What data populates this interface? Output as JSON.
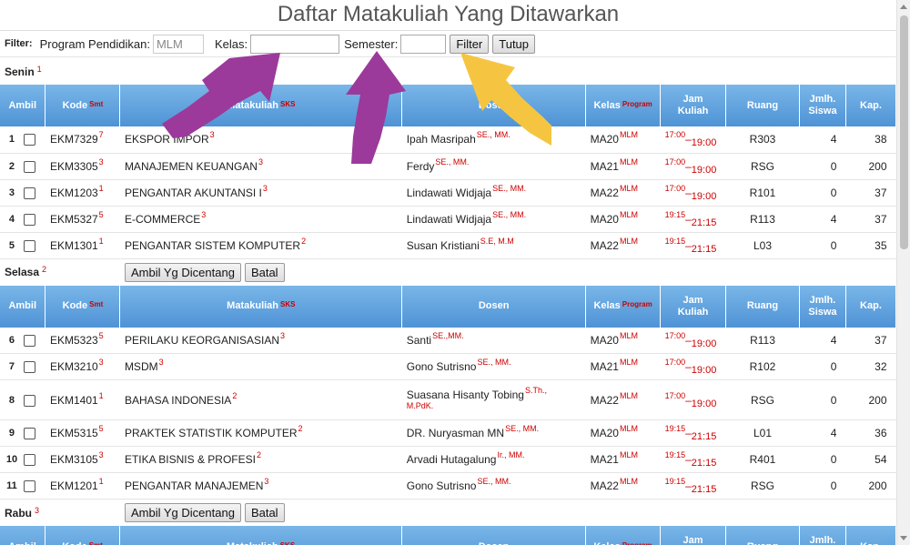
{
  "page_title": "Daftar Matakuliah Yang Ditawarkan",
  "filter": {
    "label": "Filter:",
    "program_label": "Program Pendidikan:",
    "program_value": "MLM",
    "kelas_label": "Kelas:",
    "kelas_value": "",
    "semester_label": "Semester:",
    "semester_value": "",
    "filter_button": "Filter",
    "close_button": "Tutup"
  },
  "columns": {
    "ambil": "Ambil",
    "kode": "Kode",
    "kode_sup": "Smt",
    "matakuliah": "Matakuliah",
    "matakuliah_sup": "SKS",
    "dosen": "Dosen",
    "kelas": "Kelas",
    "kelas_sup": "Program",
    "jam_line1": "Jam",
    "jam_line2": "Kuliah",
    "ruang": "Ruang",
    "jumlah_line1": "Jmlh.",
    "jumlah_line2": "Siswa",
    "kapasitas": "Kap."
  },
  "actions": {
    "take_checked": "Ambil Yg Dicentang",
    "cancel": "Batal"
  },
  "days": [
    {
      "name": "Senin",
      "sup": "1",
      "rows": [
        {
          "no": "1",
          "kode": "EKM7329",
          "smt": "7",
          "mk": "EKSPOR IMPOR",
          "sks": "3",
          "dosen": "Ipah Masripah",
          "gelar": "SE., MM.",
          "gelar2": "",
          "kelas": "MA20",
          "program": "MLM",
          "jam_start": "17:00",
          "jam_end": "19:00",
          "ruang": "R303",
          "siswa": "4",
          "kap": "38"
        },
        {
          "no": "2",
          "kode": "EKM3305",
          "smt": "3",
          "mk": "MANAJEMEN KEUANGAN",
          "sks": "3",
          "dosen": "Ferdy",
          "gelar": "SE., MM.",
          "gelar2": "",
          "kelas": "MA21",
          "program": "MLM",
          "jam_start": "17:00",
          "jam_end": "19:00",
          "ruang": "RSG",
          "siswa": "0",
          "kap": "200"
        },
        {
          "no": "3",
          "kode": "EKM1203",
          "smt": "1",
          "mk": "PENGANTAR AKUNTANSI I",
          "sks": "3",
          "dosen": "Lindawati Widjaja",
          "gelar": "SE., MM.",
          "gelar2": "",
          "kelas": "MA22",
          "program": "MLM",
          "jam_start": "17:00",
          "jam_end": "19:00",
          "ruang": "R101",
          "siswa": "0",
          "kap": "37"
        },
        {
          "no": "4",
          "kode": "EKM5327",
          "smt": "5",
          "mk": "E-COMMERCE",
          "sks": "3",
          "dosen": "Lindawati Widjaja",
          "gelar": "SE., MM.",
          "gelar2": "",
          "kelas": "MA20",
          "program": "MLM",
          "jam_start": "19:15",
          "jam_end": "21:15",
          "ruang": "R113",
          "siswa": "4",
          "kap": "37"
        },
        {
          "no": "5",
          "kode": "EKM1301",
          "smt": "1",
          "mk": "PENGANTAR SISTEM KOMPUTER",
          "sks": "2",
          "dosen": "Susan Kristiani",
          "gelar": "S.E, M.M",
          "gelar2": "",
          "kelas": "MA22",
          "program": "MLM",
          "jam_start": "19:15",
          "jam_end": "21:15",
          "ruang": "L03",
          "siswa": "0",
          "kap": "35"
        }
      ]
    },
    {
      "name": "Selasa",
      "sup": "2",
      "rows": [
        {
          "no": "6",
          "kode": "EKM5323",
          "smt": "5",
          "mk": "PERILAKU KEORGANISASIAN",
          "sks": "3",
          "dosen": "Santi",
          "gelar": "SE.,MM.",
          "gelar2": "",
          "kelas": "MA20",
          "program": "MLM",
          "jam_start": "17:00",
          "jam_end": "19:00",
          "ruang": "R113",
          "siswa": "4",
          "kap": "37"
        },
        {
          "no": "7",
          "kode": "EKM3210",
          "smt": "3",
          "mk": "MSDM",
          "sks": "3",
          "dosen": "Gono Sutrisno",
          "gelar": "SE., MM.",
          "gelar2": "",
          "kelas": "MA21",
          "program": "MLM",
          "jam_start": "17:00",
          "jam_end": "19:00",
          "ruang": "R102",
          "siswa": "0",
          "kap": "32"
        },
        {
          "no": "8",
          "kode": "EKM1401",
          "smt": "1",
          "mk": "BAHASA INDONESIA",
          "sks": "2",
          "dosen": "Suasana Hisanty Tobing",
          "gelar": "S.Th.,",
          "gelar2": "M.PdK.",
          "kelas": "MA22",
          "program": "MLM",
          "jam_start": "17:00",
          "jam_end": "19:00",
          "ruang": "RSG",
          "siswa": "0",
          "kap": "200"
        },
        {
          "no": "9",
          "kode": "EKM5315",
          "smt": "5",
          "mk": "PRAKTEK STATISTIK KOMPUTER",
          "sks": "2",
          "dosen": "DR. Nuryasman MN",
          "gelar": "SE., MM.",
          "gelar2": "",
          "kelas": "MA20",
          "program": "MLM",
          "jam_start": "19:15",
          "jam_end": "21:15",
          "ruang": "L01",
          "siswa": "4",
          "kap": "36"
        },
        {
          "no": "10",
          "kode": "EKM3105",
          "smt": "3",
          "mk": "ETIKA BISNIS & PROFESI",
          "sks": "2",
          "dosen": "Arvadi Hutagalung",
          "gelar": "Ir., MM.",
          "gelar2": "",
          "kelas": "MA21",
          "program": "MLM",
          "jam_start": "19:15",
          "jam_end": "21:15",
          "ruang": "R401",
          "siswa": "0",
          "kap": "54"
        },
        {
          "no": "11",
          "kode": "EKM1201",
          "smt": "1",
          "mk": "PENGANTAR MANAJEMEN",
          "sks": "3",
          "dosen": "Gono Sutrisno",
          "gelar": "SE., MM.",
          "gelar2": "",
          "kelas": "MA22",
          "program": "MLM",
          "jam_start": "19:15",
          "jam_end": "21:15",
          "ruang": "RSG",
          "siswa": "0",
          "kap": "200"
        }
      ]
    },
    {
      "name": "Rabu",
      "sup": "3",
      "rows": []
    }
  ],
  "annotation_colors": {
    "purple": "#9b3a9b",
    "yellow": "#f5c542"
  }
}
